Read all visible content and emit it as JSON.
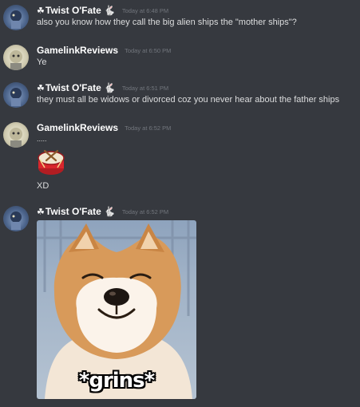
{
  "messages": [
    {
      "author": "Twist O'Fate",
      "flair": "☘",
      "badge": "🐇",
      "timestamp": "Today at 6:48 PM",
      "text": "also you know how they call the big alien ships the \"mother ships\"?"
    },
    {
      "author": "GamelinkReviews",
      "timestamp": "Today at 6:50 PM",
      "text": "Ye"
    },
    {
      "author": "Twist O'Fate",
      "flair": "☘",
      "badge": "🐇",
      "timestamp": "Today at 6:51 PM",
      "text": "they must all be widows or divorced coz you never hear about the father ships"
    },
    {
      "author": "GamelinkReviews",
      "timestamp": "Today at 6:52 PM",
      "text": ".....",
      "emoji": "drum",
      "text2": "XD"
    },
    {
      "author": "Twist O'Fate",
      "flair": "☘",
      "badge": "🐇",
      "timestamp": "Today at 6:52 PM",
      "image_caption": "*grins*"
    }
  ]
}
